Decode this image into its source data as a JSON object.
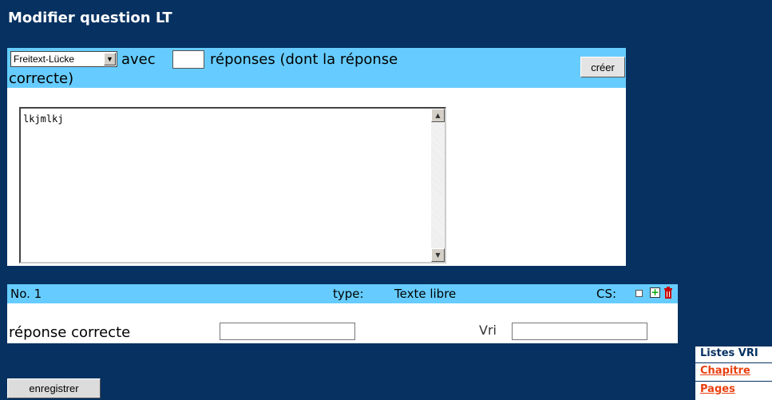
{
  "page": {
    "title": "Modifier question LT"
  },
  "toolbar": {
    "type_select_value": "Freitext-Lücke",
    "avec_label": "avec",
    "count_value": "",
    "responses_label_line1": "réponses (dont la réponse",
    "responses_label_line2": "correcte)",
    "create_label": "créer"
  },
  "question": {
    "text": "lkjmlkj"
  },
  "answer": {
    "number_label": "No. 1",
    "type_label": "type:",
    "type_value": "Texte libre",
    "cs_label": "CS:",
    "correct_label": "réponse correcte",
    "correct_value": "",
    "vri_label": "Vri",
    "vri_value": ""
  },
  "actions": {
    "save_label": "enregistrer"
  },
  "side": {
    "title": "Listes VRI",
    "links": [
      "Chapitre",
      "Pages"
    ]
  },
  "colors": {
    "background": "#063161",
    "band": "#66ccff",
    "link": "#e84010"
  }
}
